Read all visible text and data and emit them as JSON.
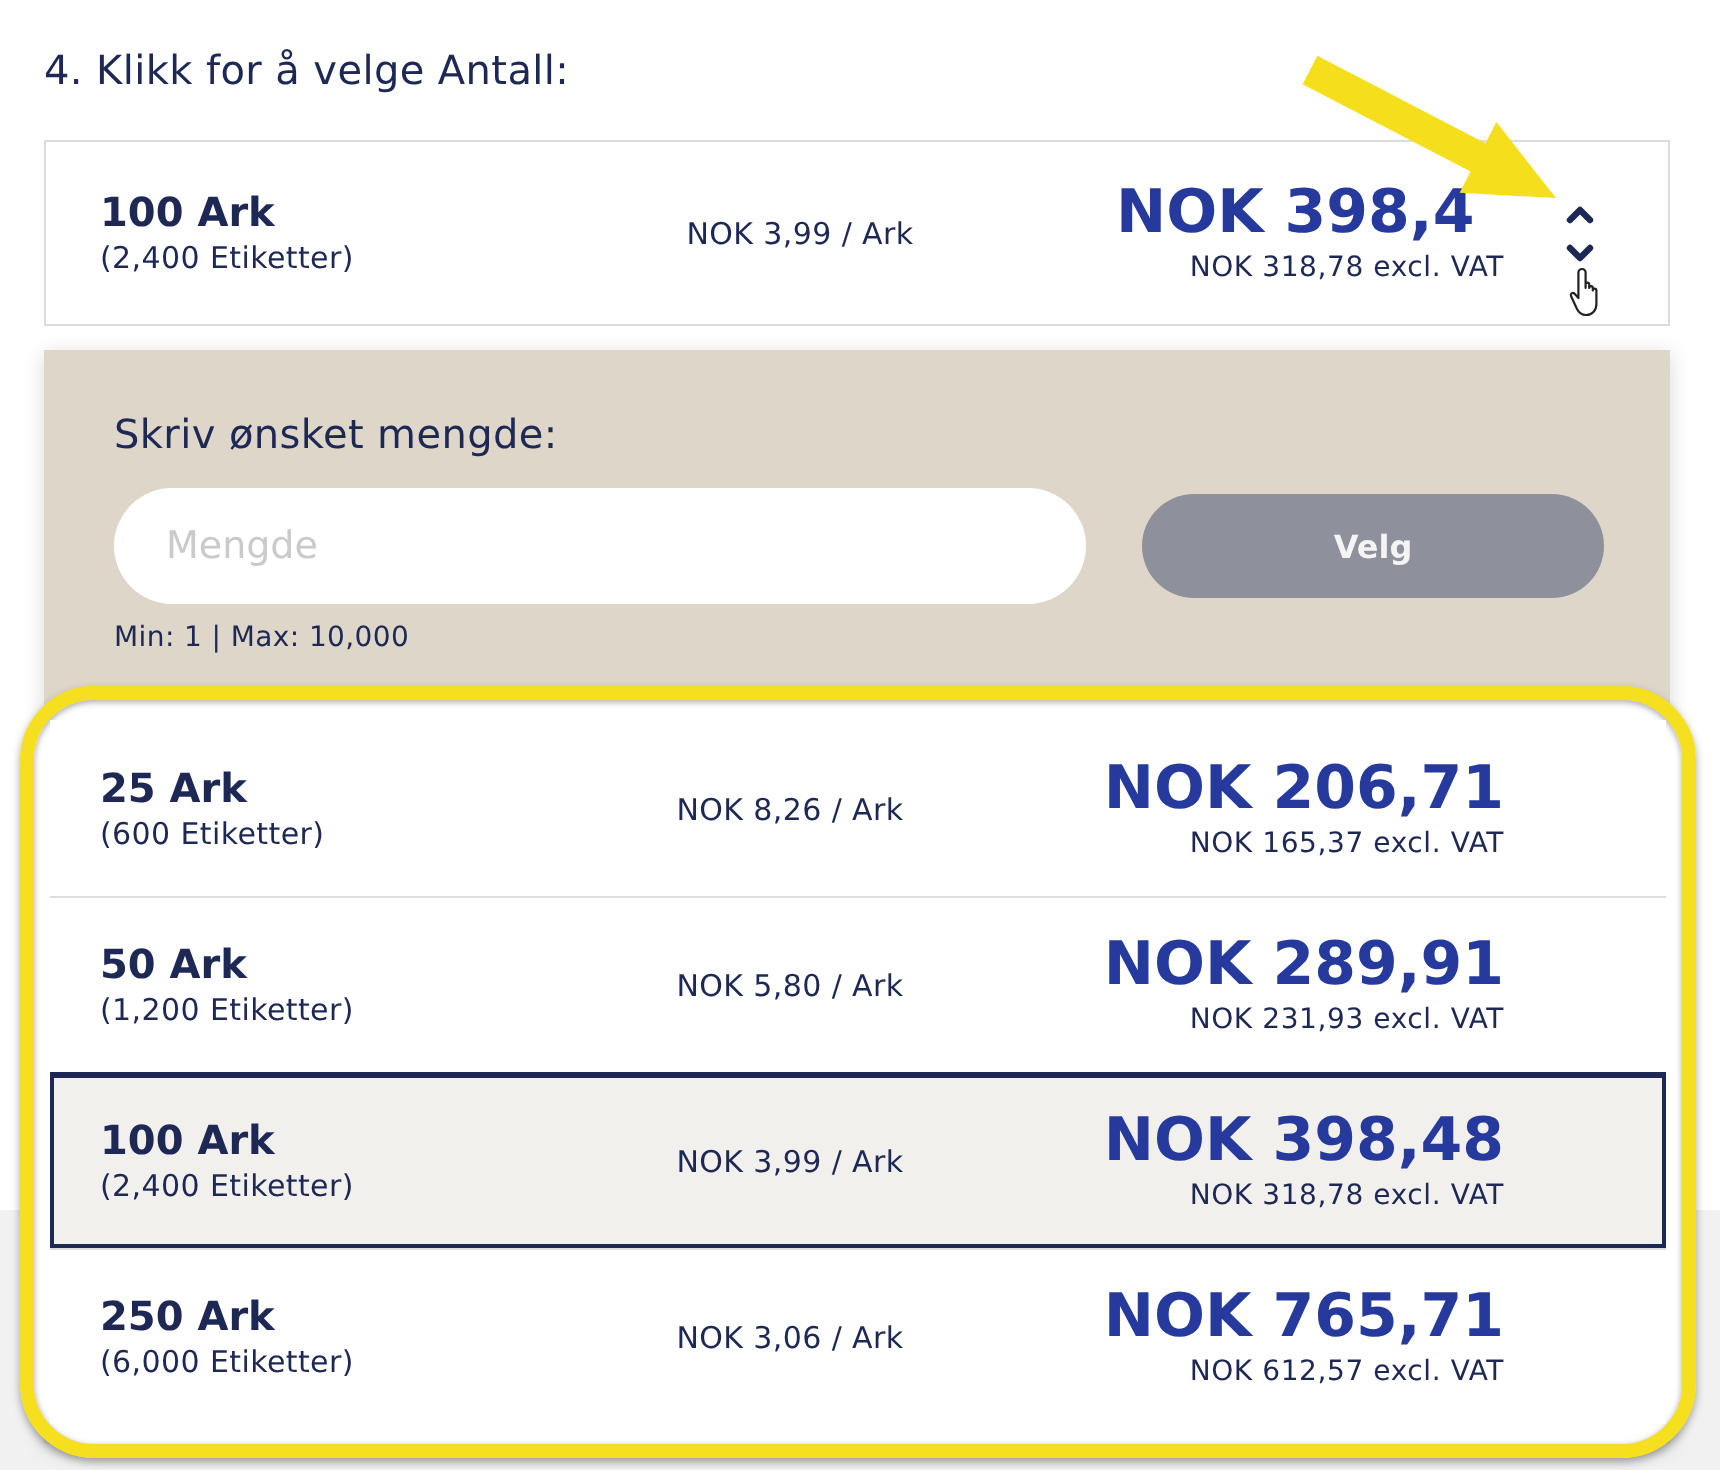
{
  "heading": "4. Klikk for å velge Antall:",
  "selector": {
    "quantity": "100 Ark",
    "labels": "(2,400 Etiketter)",
    "unit_price": "NOK 3,99 / Ark",
    "price": "NOK 398,4",
    "price_ex_vat": "NOK 318,78 excl. VAT",
    "expanded": true
  },
  "custom_quantity": {
    "label": "Skriv ønsket mengde:",
    "placeholder": "Mengde",
    "button": "Velg",
    "button_disabled": true,
    "limits": "Min: 1 | Max: 10,000"
  },
  "options": [
    {
      "quantity": "25 Ark",
      "labels": "(600 Etiketter)",
      "unit_price": "NOK 8,26 / Ark",
      "price": "NOK 206,71",
      "price_ex_vat": "NOK 165,37 excl. VAT",
      "selected": false
    },
    {
      "quantity": "50 Ark",
      "labels": "(1,200 Etiketter)",
      "unit_price": "NOK 5,80 / Ark",
      "price": "NOK 289,91",
      "price_ex_vat": "NOK 231,93 excl. VAT",
      "selected": false
    },
    {
      "quantity": "100 Ark",
      "labels": "(2,400 Etiketter)",
      "unit_price": "NOK 3,99 / Ark",
      "price": "NOK 398,48",
      "price_ex_vat": "NOK 318,78 excl. VAT",
      "selected": true
    },
    {
      "quantity": "250 Ark",
      "labels": "(6,000 Etiketter)",
      "unit_price": "NOK 3,06 / Ark",
      "price": "NOK 765,71",
      "price_ex_vat": "NOK 612,57 excl. VAT",
      "selected": false
    }
  ]
}
